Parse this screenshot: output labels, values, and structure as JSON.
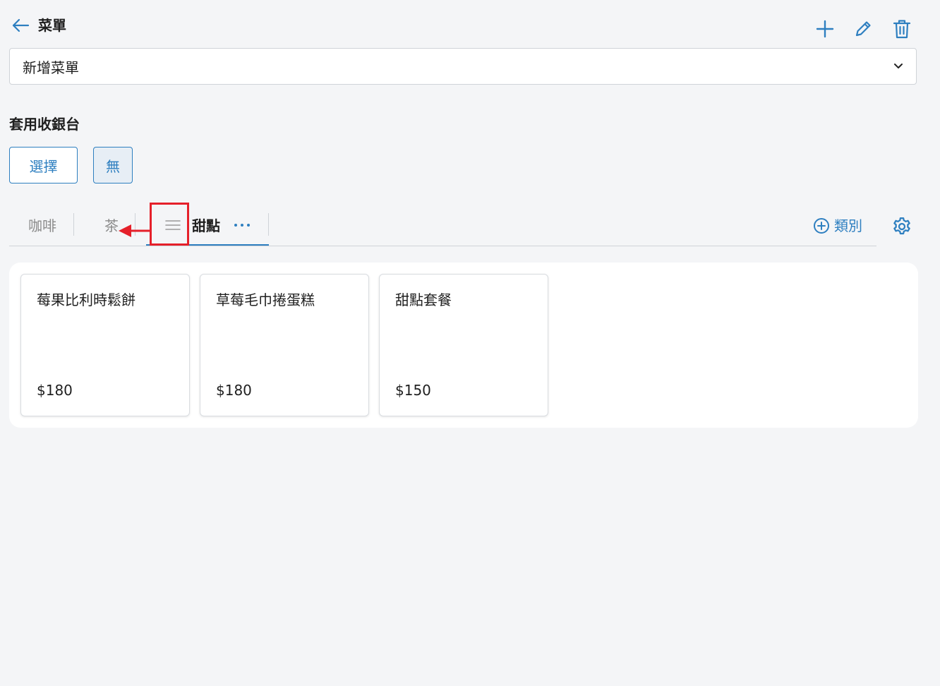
{
  "header": {
    "title": "菜單",
    "back_icon": "arrow-left-icon",
    "actions": [
      "plus-icon",
      "pencil-icon",
      "trash-icon"
    ]
  },
  "menu_select": {
    "value": "新增菜單"
  },
  "register_section": {
    "title": "套用收銀台",
    "select_label": "選擇",
    "none_label": "無"
  },
  "tabs": {
    "items": [
      {
        "label": "咖啡"
      },
      {
        "label": "茶"
      },
      {
        "label": "甜點",
        "active": true
      }
    ],
    "add_category_label": "類別"
  },
  "products": [
    {
      "name": "莓果比利時鬆餅",
      "price": "$180"
    },
    {
      "name": "草莓毛巾捲蛋糕",
      "price": "$180"
    },
    {
      "name": "甜點套餐",
      "price": "$150"
    }
  ],
  "colors": {
    "accent": "#2e7fc0",
    "annotation": "#e5202a",
    "background": "#f4f5f7"
  }
}
